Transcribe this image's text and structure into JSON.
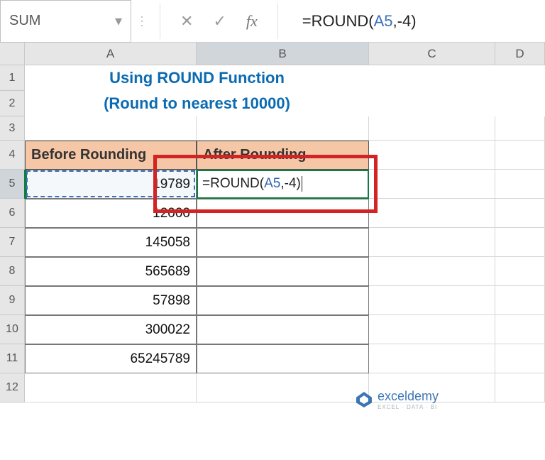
{
  "formula_bar": {
    "name_box": "SUM",
    "formula_display": "=ROUND(A5,-4)",
    "cancel_icon": "✕",
    "enter_icon": "✓",
    "fx_icon": "fx"
  },
  "columns": [
    "A",
    "B",
    "C",
    "D"
  ],
  "rows": [
    1,
    2,
    3,
    4,
    5,
    6,
    7,
    8,
    9,
    10,
    11,
    12
  ],
  "title_line1": "Using ROUND Function",
  "title_line2": "(Round to nearest 10000)",
  "headers": {
    "before": "Before Rounding",
    "after": "After Rounding"
  },
  "data": {
    "A5": "19789",
    "A6": "12000",
    "A7": "145058",
    "A8": "565689",
    "A9": "57898",
    "A10": "300022",
    "A11": "65245789"
  },
  "editing_formula": {
    "eq": "=",
    "fn": "ROUND",
    "open": "(",
    "ref": "A5",
    "comma": ",",
    "arg": "-4",
    "close": ")"
  },
  "watermark": {
    "name": "exceldemy",
    "sub": "EXCEL · DATA · BI"
  },
  "chart_data": {
    "type": "table",
    "title": "Using ROUND Function (Round to nearest 10000)",
    "columns": [
      "Before Rounding",
      "After Rounding"
    ],
    "rows": [
      {
        "before": 19789,
        "after_formula": "=ROUND(A5,-4)"
      },
      {
        "before": 12000
      },
      {
        "before": 145058
      },
      {
        "before": 565689
      },
      {
        "before": 57898
      },
      {
        "before": 300022
      },
      {
        "before": 65245789
      }
    ],
    "active_cell": "B5",
    "reference_cell": "A5"
  }
}
